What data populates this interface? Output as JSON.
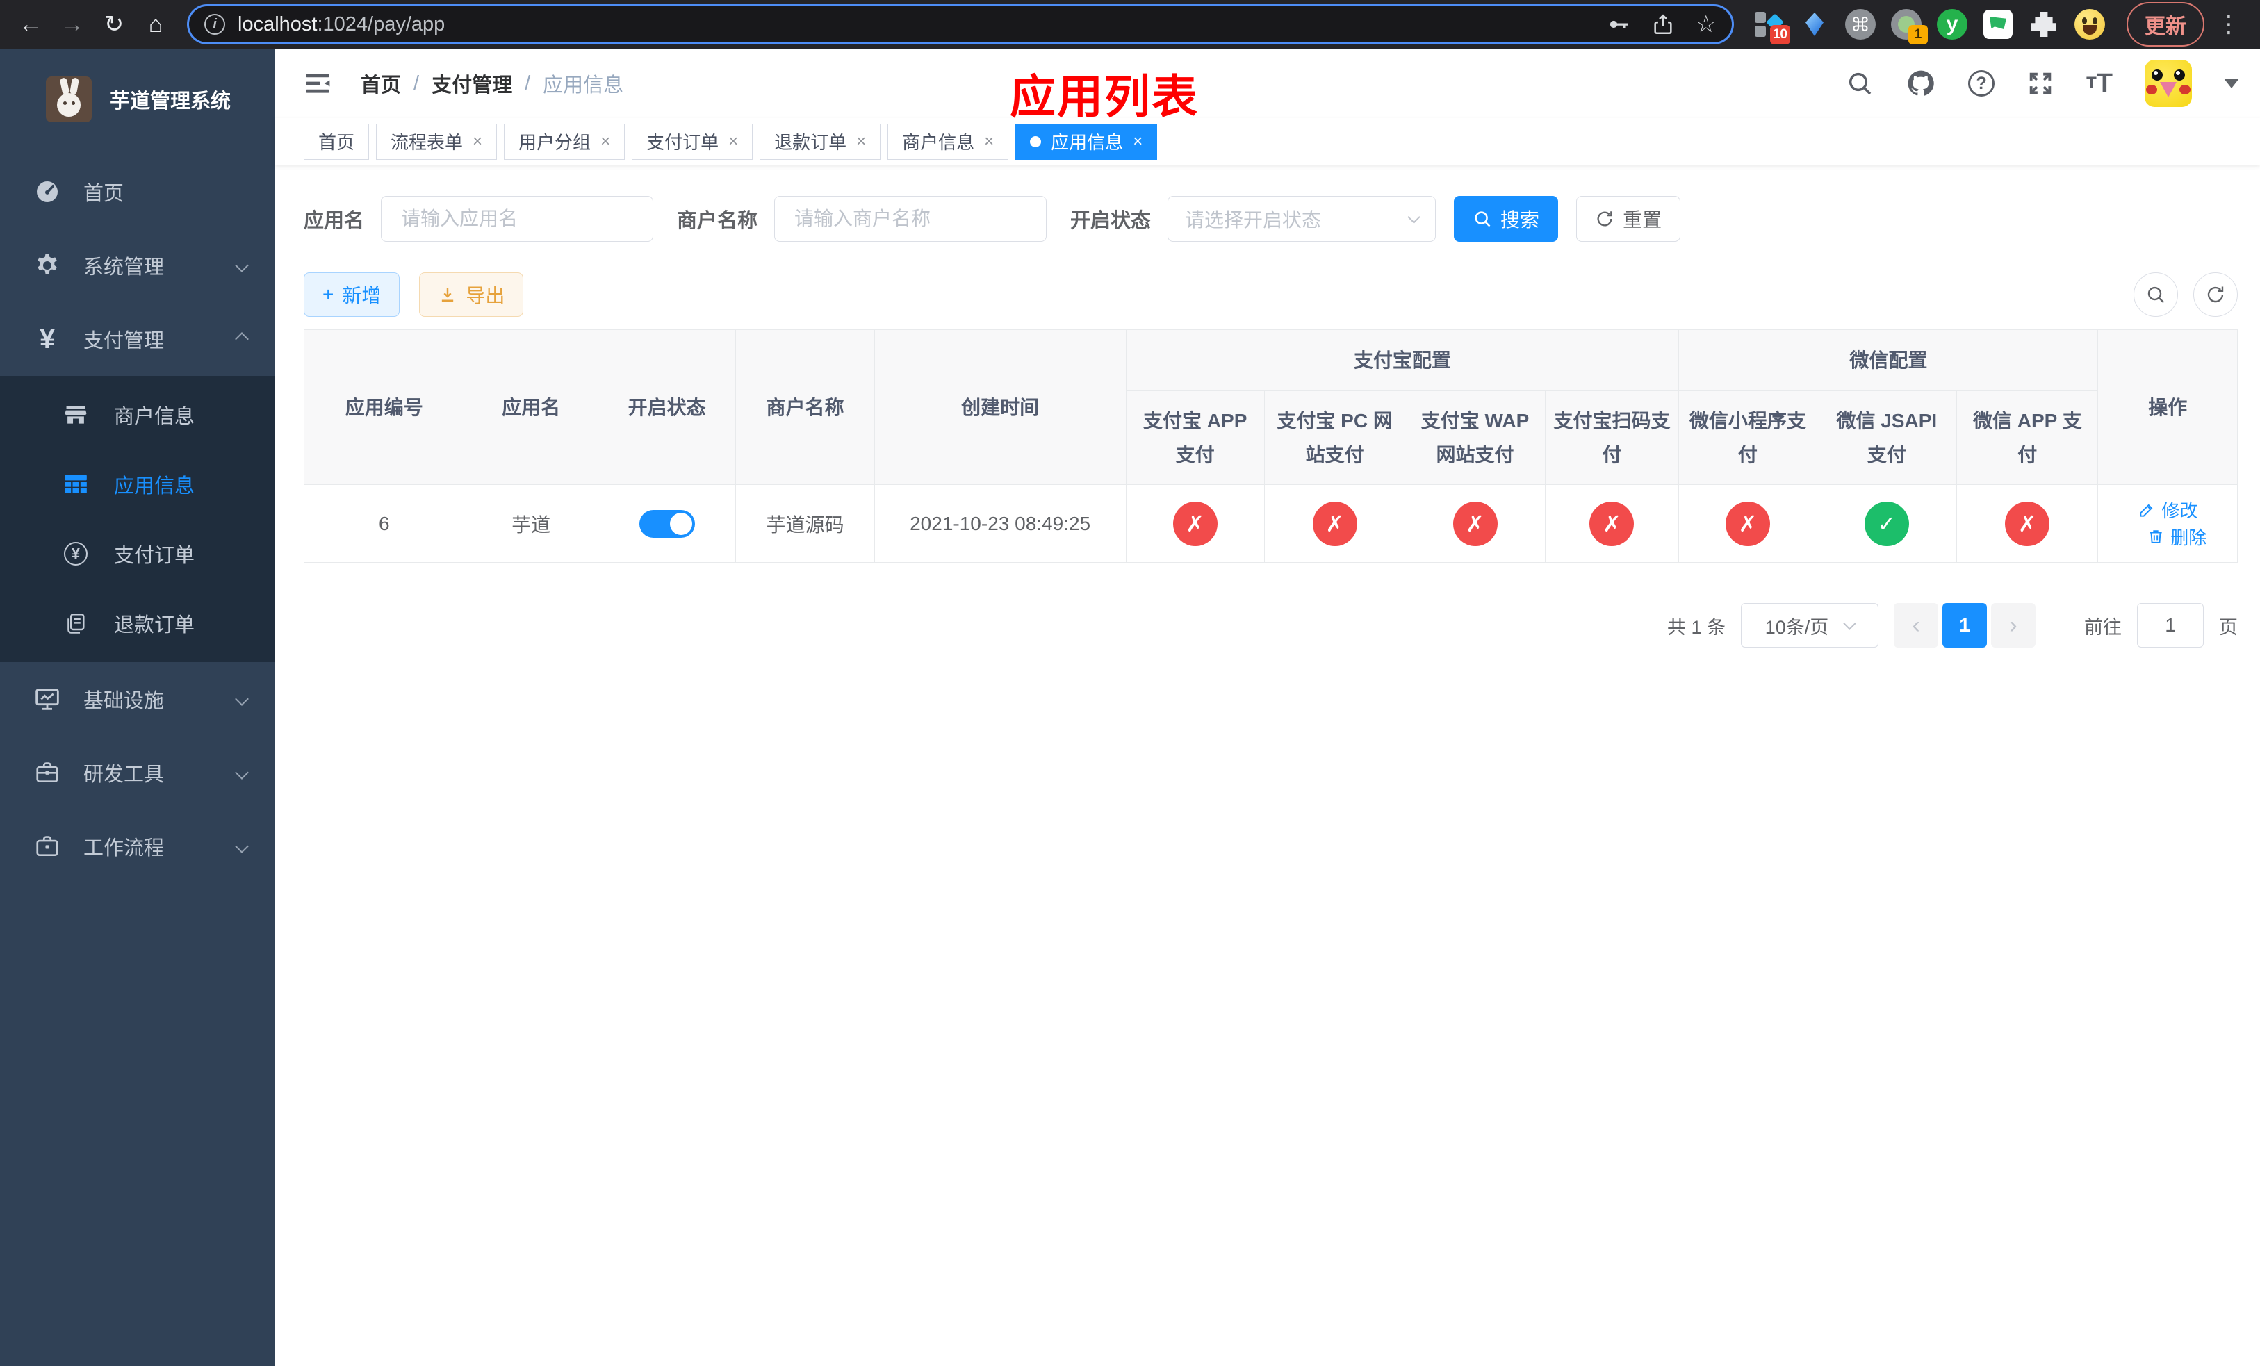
{
  "browser": {
    "url_host": "localhost",
    "url_rest": ":1024/pay/app",
    "update_button": "更新",
    "extension_badge_a": "10",
    "extension_badge_b": "1",
    "extension_y_label": "y"
  },
  "sidebar": {
    "logo_title": "芋道管理系统",
    "menu_top": [
      {
        "label": "首页"
      },
      {
        "label": "系统管理"
      },
      {
        "label": "支付管理"
      }
    ],
    "submenu": [
      {
        "label": "商户信息"
      },
      {
        "label": "应用信息"
      },
      {
        "label": "支付订单"
      },
      {
        "label": "退款订单"
      }
    ],
    "menu_bottom": [
      {
        "label": "基础设施"
      },
      {
        "label": "研发工具"
      },
      {
        "label": "工作流程"
      }
    ]
  },
  "header": {
    "breadcrumb": [
      "首页",
      "支付管理",
      "应用信息"
    ],
    "annotation": "应用列表",
    "help_glyph": "?"
  },
  "tabs": [
    {
      "label": "首页"
    },
    {
      "label": "流程表单"
    },
    {
      "label": "用户分组"
    },
    {
      "label": "支付订单"
    },
    {
      "label": "退款订单"
    },
    {
      "label": "商户信息"
    },
    {
      "label": "应用信息"
    }
  ],
  "filters": {
    "app_name_label": "应用名",
    "app_name_placeholder": "请输入应用名",
    "merchant_label": "商户名称",
    "merchant_placeholder": "请输入商户名称",
    "status_label": "开启状态",
    "status_placeholder": "请选择开启状态",
    "search_button": "搜索",
    "reset_button": "重置"
  },
  "toolbar": {
    "add_button": "新增",
    "export_button": "导出",
    "add_plus": "+"
  },
  "table": {
    "columns": [
      "应用编号",
      "应用名",
      "开启状态",
      "商户名称",
      "创建时间"
    ],
    "alipay_group": "支付宝配置",
    "wechat_group": "微信配置",
    "alipay_columns": [
      "支付宝 APP 支付",
      "支付宝 PC 网站支付",
      "支付宝 WAP 网站支付",
      "支付宝扫码支付"
    ],
    "wechat_columns": [
      "微信小程序支付",
      "微信 JSAPI 支付",
      "微信 APP 支付"
    ],
    "actions_column": "操作",
    "row": {
      "id": "6",
      "name": "芋道",
      "enabled": true,
      "merchant": "芋道源码",
      "created_at": "2021-10-23 08:49:25",
      "channels": [
        "disabled",
        "disabled",
        "disabled",
        "disabled",
        "disabled",
        "enabled",
        "disabled"
      ],
      "edit_link": "修改",
      "delete_link": "删除"
    }
  },
  "pagination": {
    "total": "共 1 条",
    "page_size": "10条/页",
    "prev_glyph": "‹",
    "next_glyph": "›",
    "current_page": "1",
    "goto_label": "前往",
    "goto_value": "1",
    "goto_suffix": "页"
  },
  "colors": {
    "accent": "#1890ff",
    "danger": "#f24b4b",
    "success": "#1cbe6a",
    "annotation": "#fe0000",
    "sidebar": "#304156",
    "sidebar_sub": "#1f2d3d"
  }
}
